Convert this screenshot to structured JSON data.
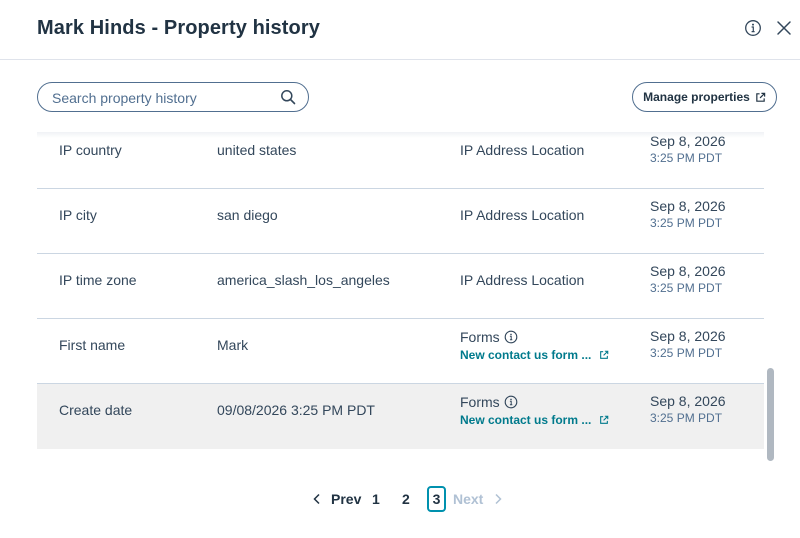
{
  "header": {
    "title": "Mark Hinds - Property history"
  },
  "search": {
    "placeholder": "Search property history"
  },
  "toolbar": {
    "manage_label": "Manage properties"
  },
  "rows": [
    {
      "name": "IP country",
      "value": "united states",
      "source": "IP Address Location",
      "date": "Sep 8, 2026",
      "time": "3:25 PM PDT"
    },
    {
      "name": "IP city",
      "value": "san diego",
      "source": "IP Address Location",
      "date": "Sep 8, 2026",
      "time": "3:25 PM PDT"
    },
    {
      "name": "IP time zone",
      "value": "america_slash_los_angeles",
      "source": "IP Address Location",
      "date": "Sep 8, 2026",
      "time": "3:25 PM PDT"
    },
    {
      "name": "First name",
      "value": "Mark",
      "source": "Forms",
      "source_link": "New contact us form ...",
      "date": "Sep 8, 2026",
      "time": "3:25 PM PDT"
    },
    {
      "name": "Create date",
      "value": "09/08/2026 3:25 PM PDT",
      "source": "Forms",
      "source_link": "New contact us form ...",
      "date": "Sep 8, 2026",
      "time": "3:25 PM PDT"
    }
  ],
  "pagination": {
    "prev": "Prev",
    "pages": [
      "1",
      "2",
      "3"
    ],
    "current": "3",
    "next": "Next"
  },
  "colors": {
    "accent": "#0091ae",
    "link": "#007a8c",
    "highlight_row": "#f0f0f0"
  },
  "icons": {
    "info": "info-icon",
    "close": "close-icon",
    "search": "search-icon",
    "external": "external-link-icon"
  }
}
